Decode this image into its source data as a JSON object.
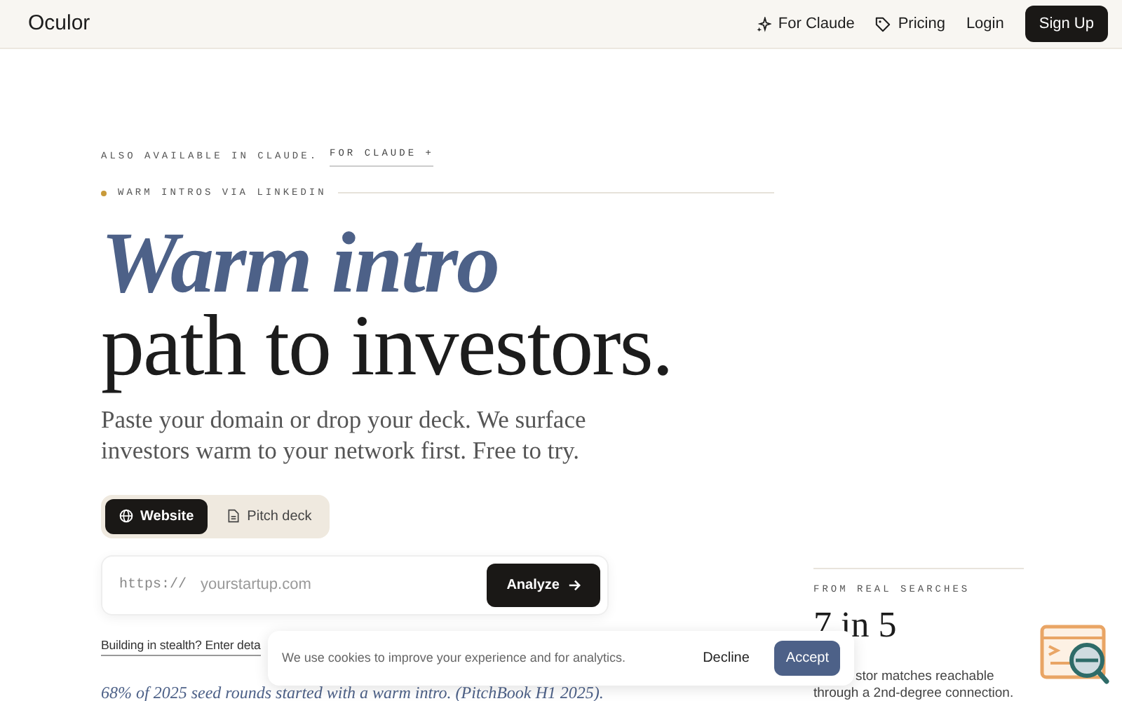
{
  "nav": {
    "brand": "Oculor",
    "links": [
      {
        "label": "For Claude"
      },
      {
        "label": "Pricing"
      },
      {
        "label": "Login"
      }
    ],
    "cta": "Sign Up"
  },
  "hero": {
    "availability": "ALSO AVAILABLE IN CLAUDE.",
    "availability_link": "FOR CLAUDE +",
    "eyebrow": "WARM INTROS VIA LINKEDIN",
    "title_accent": "Warm intro",
    "title": "path to investors.",
    "subtitle": "Paste your domain or drop your deck. We surface investors warm to your network first. Free to try."
  },
  "input_modes": [
    {
      "label": "Website",
      "selected": true
    },
    {
      "label": "Pitch deck",
      "selected": false
    }
  ],
  "url_field": {
    "prefix": "https://",
    "placeholder": "yourstartup.com",
    "button": "Analyze"
  },
  "stealth_link": "Building in stealth? Enter deta",
  "quote": "68% of 2025 seed rounds started with a warm intro. (PitchBook H1 2025).",
  "stat": {
    "label": "FROM REAL SEARCHES",
    "value": "7 in 5",
    "lines": [
      "stor matches reachable",
      "through a 2nd-degree connection."
    ]
  },
  "cookie_banner": {
    "message": "We use cookies to improve your experience and for analytics.",
    "buttons": [
      {
        "label": "Decline",
        "kind": "secondary"
      },
      {
        "label": "Accept",
        "kind": "primary"
      }
    ]
  }
}
